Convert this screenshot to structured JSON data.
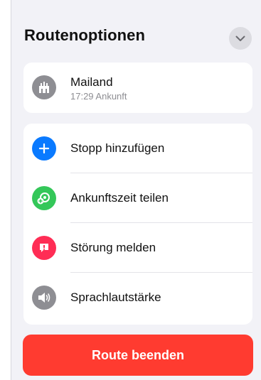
{
  "header": {
    "title": "Routenoptionen",
    "collapse_icon": "chevron-down-icon"
  },
  "destination": {
    "name": "Mailand",
    "subtitle": "17:29 Ankunft",
    "icon": "landmark-icon"
  },
  "options": [
    {
      "label": "Stopp hinzufügen",
      "icon": "plus-icon",
      "color": "#0a7aff"
    },
    {
      "label": "Ankunftszeit teilen",
      "icon": "share-eta-icon",
      "color": "#34c759"
    },
    {
      "label": "Störung melden",
      "icon": "alert-icon",
      "color": "#ff2d55"
    },
    {
      "label": "Sprachlautstärke",
      "icon": "speaker-icon",
      "color": "#8e8e93"
    }
  ],
  "end_button": {
    "label": "Route beenden",
    "color": "#ff3b30"
  }
}
